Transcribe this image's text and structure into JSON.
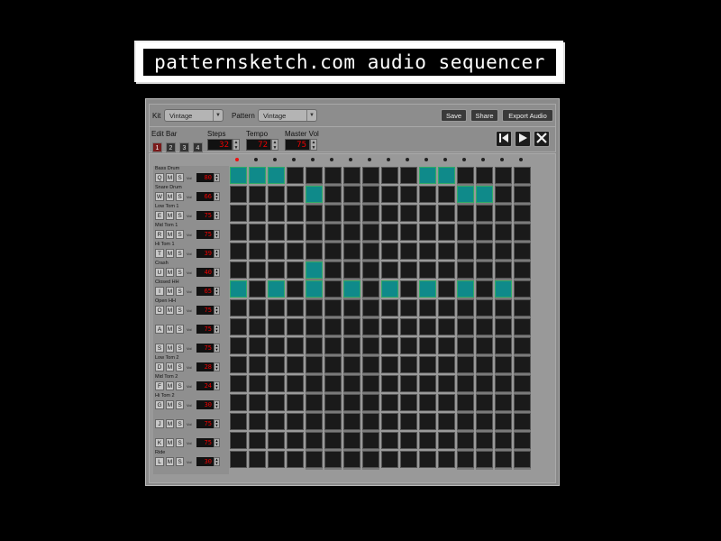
{
  "title": "patternsketch.com audio sequencer",
  "toolbar": {
    "kit_label": "Kit",
    "kit_value": "Vintage",
    "pattern_label": "Pattern",
    "pattern_value": "Vintage",
    "save_label": "Save",
    "share_label": "Share",
    "export_label": "Export Audio"
  },
  "controls": {
    "edit_bar_label": "Edit Bar",
    "bars": [
      "1",
      "2",
      "3",
      "4"
    ],
    "active_bar": 0,
    "steps_label": "Steps",
    "steps_value": "32",
    "tempo_label": "Tempo",
    "tempo_value": "72",
    "master_vol_label": "Master Vol",
    "master_vol_value": "75"
  },
  "transport": {
    "rewind_icon": "skip-back-icon",
    "play_icon": "play-icon",
    "stop_icon": "stop-icon"
  },
  "vol_label": "Vol",
  "mute_label": "M",
  "solo_label": "S",
  "active_step": 0,
  "tracks": [
    {
      "name": "Bass Drum",
      "key": "Q",
      "vol": "80"
    },
    {
      "name": "Snare Drum",
      "key": "W",
      "vol": "66"
    },
    {
      "name": "Low Tom 1",
      "key": "E",
      "vol": "75"
    },
    {
      "name": "Mid Tom 1",
      "key": "R",
      "vol": "75"
    },
    {
      "name": "Hi Tom 1",
      "key": "T",
      "vol": "39"
    },
    {
      "name": "Crash",
      "key": "U",
      "vol": "40"
    },
    {
      "name": "Closed HH",
      "key": "I",
      "vol": "65"
    },
    {
      "name": "Open HH",
      "key": "O",
      "vol": "75"
    },
    {
      "name": "",
      "key": "A",
      "vol": "75"
    },
    {
      "name": "",
      "key": "S",
      "vol": "75"
    },
    {
      "name": "Low Tom 2",
      "key": "D",
      "vol": "28"
    },
    {
      "name": "Mid Tom 2",
      "key": "F",
      "vol": "24"
    },
    {
      "name": "Hi Tom 2",
      "key": "G",
      "vol": "30"
    },
    {
      "name": "",
      "key": "J",
      "vol": "75"
    },
    {
      "name": "",
      "key": "K",
      "vol": "75"
    },
    {
      "name": "Ride",
      "key": "L",
      "vol": "30"
    }
  ],
  "pattern": [
    [
      1,
      1,
      1,
      0,
      0,
      0,
      0,
      0,
      0,
      0,
      1,
      1,
      0,
      0,
      0,
      0
    ],
    [
      0,
      0,
      0,
      0,
      1,
      0,
      0,
      0,
      0,
      0,
      0,
      0,
      1,
      1,
      0,
      0
    ],
    [
      0,
      0,
      0,
      0,
      0,
      0,
      0,
      0,
      0,
      0,
      0,
      0,
      0,
      0,
      0,
      0
    ],
    [
      0,
      0,
      0,
      0,
      0,
      0,
      0,
      0,
      0,
      0,
      0,
      0,
      0,
      0,
      0,
      0
    ],
    [
      0,
      0,
      0,
      0,
      0,
      0,
      0,
      0,
      0,
      0,
      0,
      0,
      0,
      0,
      0,
      0
    ],
    [
      0,
      0,
      0,
      0,
      1,
      0,
      0,
      0,
      0,
      0,
      0,
      0,
      0,
      0,
      0,
      0
    ],
    [
      1,
      0,
      1,
      0,
      1,
      0,
      1,
      0,
      1,
      0,
      1,
      0,
      1,
      0,
      1,
      0
    ],
    [
      0,
      0,
      0,
      0,
      0,
      0,
      0,
      0,
      0,
      0,
      0,
      0,
      0,
      0,
      0,
      0
    ],
    [
      0,
      0,
      0,
      0,
      0,
      0,
      0,
      0,
      0,
      0,
      0,
      0,
      0,
      0,
      0,
      0
    ],
    [
      0,
      0,
      0,
      0,
      0,
      0,
      0,
      0,
      0,
      0,
      0,
      0,
      0,
      0,
      0,
      0
    ],
    [
      0,
      0,
      0,
      0,
      0,
      0,
      0,
      0,
      0,
      0,
      0,
      0,
      0,
      0,
      0,
      0
    ],
    [
      0,
      0,
      0,
      0,
      0,
      0,
      0,
      0,
      0,
      0,
      0,
      0,
      0,
      0,
      0,
      0
    ],
    [
      0,
      0,
      0,
      0,
      0,
      0,
      0,
      0,
      0,
      0,
      0,
      0,
      0,
      0,
      0,
      0
    ],
    [
      0,
      0,
      0,
      0,
      0,
      0,
      0,
      0,
      0,
      0,
      0,
      0,
      0,
      0,
      0,
      0
    ],
    [
      0,
      0,
      0,
      0,
      0,
      0,
      0,
      0,
      0,
      0,
      0,
      0,
      0,
      0,
      0,
      0
    ],
    [
      0,
      0,
      0,
      0,
      0,
      0,
      0,
      0,
      0,
      0,
      0,
      0,
      0,
      0,
      0,
      0
    ]
  ],
  "colors": {
    "step_on": "#0f8a8a",
    "step_off": "#1a1a1a",
    "led_active": "#e11",
    "lcd_text": "#e00"
  }
}
